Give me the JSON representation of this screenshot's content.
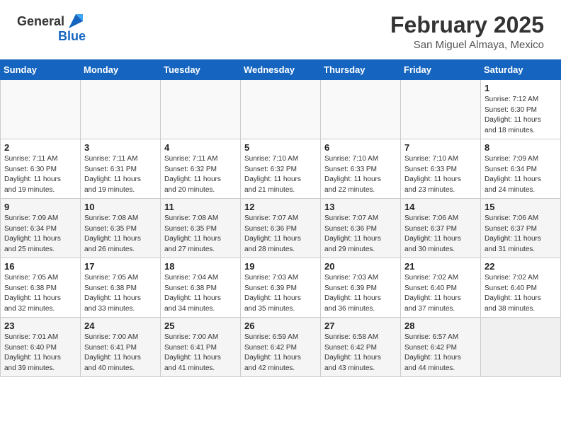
{
  "logo": {
    "general": "General",
    "blue": "Blue"
  },
  "header": {
    "month_year": "February 2025",
    "location": "San Miguel Almaya, Mexico"
  },
  "days_of_week": [
    "Sunday",
    "Monday",
    "Tuesday",
    "Wednesday",
    "Thursday",
    "Friday",
    "Saturday"
  ],
  "weeks": [
    {
      "alt": false,
      "days": [
        {
          "num": "",
          "info": ""
        },
        {
          "num": "",
          "info": ""
        },
        {
          "num": "",
          "info": ""
        },
        {
          "num": "",
          "info": ""
        },
        {
          "num": "",
          "info": ""
        },
        {
          "num": "",
          "info": ""
        },
        {
          "num": "1",
          "info": "Sunrise: 7:12 AM\nSunset: 6:30 PM\nDaylight: 11 hours\nand 18 minutes."
        }
      ]
    },
    {
      "alt": false,
      "days": [
        {
          "num": "2",
          "info": "Sunrise: 7:11 AM\nSunset: 6:30 PM\nDaylight: 11 hours\nand 19 minutes."
        },
        {
          "num": "3",
          "info": "Sunrise: 7:11 AM\nSunset: 6:31 PM\nDaylight: 11 hours\nand 19 minutes."
        },
        {
          "num": "4",
          "info": "Sunrise: 7:11 AM\nSunset: 6:32 PM\nDaylight: 11 hours\nand 20 minutes."
        },
        {
          "num": "5",
          "info": "Sunrise: 7:10 AM\nSunset: 6:32 PM\nDaylight: 11 hours\nand 21 minutes."
        },
        {
          "num": "6",
          "info": "Sunrise: 7:10 AM\nSunset: 6:33 PM\nDaylight: 11 hours\nand 22 minutes."
        },
        {
          "num": "7",
          "info": "Sunrise: 7:10 AM\nSunset: 6:33 PM\nDaylight: 11 hours\nand 23 minutes."
        },
        {
          "num": "8",
          "info": "Sunrise: 7:09 AM\nSunset: 6:34 PM\nDaylight: 11 hours\nand 24 minutes."
        }
      ]
    },
    {
      "alt": true,
      "days": [
        {
          "num": "9",
          "info": "Sunrise: 7:09 AM\nSunset: 6:34 PM\nDaylight: 11 hours\nand 25 minutes."
        },
        {
          "num": "10",
          "info": "Sunrise: 7:08 AM\nSunset: 6:35 PM\nDaylight: 11 hours\nand 26 minutes."
        },
        {
          "num": "11",
          "info": "Sunrise: 7:08 AM\nSunset: 6:35 PM\nDaylight: 11 hours\nand 27 minutes."
        },
        {
          "num": "12",
          "info": "Sunrise: 7:07 AM\nSunset: 6:36 PM\nDaylight: 11 hours\nand 28 minutes."
        },
        {
          "num": "13",
          "info": "Sunrise: 7:07 AM\nSunset: 6:36 PM\nDaylight: 11 hours\nand 29 minutes."
        },
        {
          "num": "14",
          "info": "Sunrise: 7:06 AM\nSunset: 6:37 PM\nDaylight: 11 hours\nand 30 minutes."
        },
        {
          "num": "15",
          "info": "Sunrise: 7:06 AM\nSunset: 6:37 PM\nDaylight: 11 hours\nand 31 minutes."
        }
      ]
    },
    {
      "alt": false,
      "days": [
        {
          "num": "16",
          "info": "Sunrise: 7:05 AM\nSunset: 6:38 PM\nDaylight: 11 hours\nand 32 minutes."
        },
        {
          "num": "17",
          "info": "Sunrise: 7:05 AM\nSunset: 6:38 PM\nDaylight: 11 hours\nand 33 minutes."
        },
        {
          "num": "18",
          "info": "Sunrise: 7:04 AM\nSunset: 6:38 PM\nDaylight: 11 hours\nand 34 minutes."
        },
        {
          "num": "19",
          "info": "Sunrise: 7:03 AM\nSunset: 6:39 PM\nDaylight: 11 hours\nand 35 minutes."
        },
        {
          "num": "20",
          "info": "Sunrise: 7:03 AM\nSunset: 6:39 PM\nDaylight: 11 hours\nand 36 minutes."
        },
        {
          "num": "21",
          "info": "Sunrise: 7:02 AM\nSunset: 6:40 PM\nDaylight: 11 hours\nand 37 minutes."
        },
        {
          "num": "22",
          "info": "Sunrise: 7:02 AM\nSunset: 6:40 PM\nDaylight: 11 hours\nand 38 minutes."
        }
      ]
    },
    {
      "alt": true,
      "days": [
        {
          "num": "23",
          "info": "Sunrise: 7:01 AM\nSunset: 6:40 PM\nDaylight: 11 hours\nand 39 minutes."
        },
        {
          "num": "24",
          "info": "Sunrise: 7:00 AM\nSunset: 6:41 PM\nDaylight: 11 hours\nand 40 minutes."
        },
        {
          "num": "25",
          "info": "Sunrise: 7:00 AM\nSunset: 6:41 PM\nDaylight: 11 hours\nand 41 minutes."
        },
        {
          "num": "26",
          "info": "Sunrise: 6:59 AM\nSunset: 6:42 PM\nDaylight: 11 hours\nand 42 minutes."
        },
        {
          "num": "27",
          "info": "Sunrise: 6:58 AM\nSunset: 6:42 PM\nDaylight: 11 hours\nand 43 minutes."
        },
        {
          "num": "28",
          "info": "Sunrise: 6:57 AM\nSunset: 6:42 PM\nDaylight: 11 hours\nand 44 minutes."
        },
        {
          "num": "",
          "info": ""
        }
      ]
    }
  ]
}
